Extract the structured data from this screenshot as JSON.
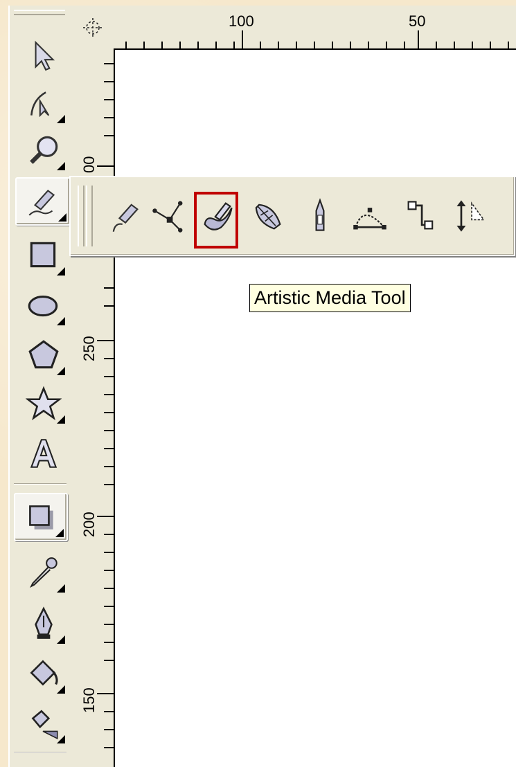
{
  "ruler_top": {
    "labels": [
      "100",
      "50"
    ]
  },
  "ruler_left": {
    "labels": [
      "00",
      "250",
      "200",
      "150"
    ]
  },
  "toolbox": {
    "tools": [
      {
        "name": "pick-tool",
        "icon": "arrow-cursor-icon",
        "flyout": false
      },
      {
        "name": "shape-tool",
        "icon": "shape-node-icon",
        "flyout": true
      },
      {
        "name": "zoom-tool",
        "icon": "magnifier-icon",
        "flyout": true
      },
      {
        "name": "freehand-tool",
        "icon": "pencil-icon",
        "flyout": true,
        "active": true
      },
      {
        "name": "rectangle-tool",
        "icon": "rectangle-icon",
        "flyout": true
      },
      {
        "name": "ellipse-tool",
        "icon": "ellipse-icon",
        "flyout": true
      },
      {
        "name": "polygon-tool",
        "icon": "pentagon-icon",
        "flyout": true
      },
      {
        "name": "basic-shapes-tool",
        "icon": "star-icon",
        "flyout": true
      },
      {
        "name": "text-tool",
        "icon": "letter-a-icon",
        "flyout": false
      },
      {
        "name": "interactive-drop-shadow-tool",
        "icon": "shadow-square-icon",
        "flyout": true,
        "active": true
      },
      {
        "name": "eyedropper-tool",
        "icon": "eyedropper-icon",
        "flyout": true
      },
      {
        "name": "outline-tool",
        "icon": "pen-nib-icon",
        "flyout": true
      },
      {
        "name": "fill-tool",
        "icon": "paint-bucket-icon",
        "flyout": true
      },
      {
        "name": "interactive-fill-tool",
        "icon": "fill-bucket-arrow-icon",
        "flyout": true
      }
    ]
  },
  "flyout": {
    "tools": [
      {
        "name": "freehand",
        "icon": "pencil-curve-icon"
      },
      {
        "name": "bezier",
        "icon": "bezier-nodes-icon"
      },
      {
        "name": "artistic-media",
        "icon": "brush-stroke-icon",
        "highlighted": true
      },
      {
        "name": "pen",
        "icon": "pen-nib-flyout-icon"
      },
      {
        "name": "polyline",
        "icon": "polyline-icon"
      },
      {
        "name": "3-point-curve",
        "icon": "three-point-curve-icon"
      },
      {
        "name": "interactive-connector",
        "icon": "connector-icon"
      },
      {
        "name": "dimension",
        "icon": "dimension-icon"
      }
    ]
  },
  "tooltip": {
    "text": "Artistic Media Tool"
  },
  "colors": {
    "highlight": "#c00000",
    "tooltip_bg": "#ffffe1",
    "toolbar_bg": "#ece9d8"
  }
}
